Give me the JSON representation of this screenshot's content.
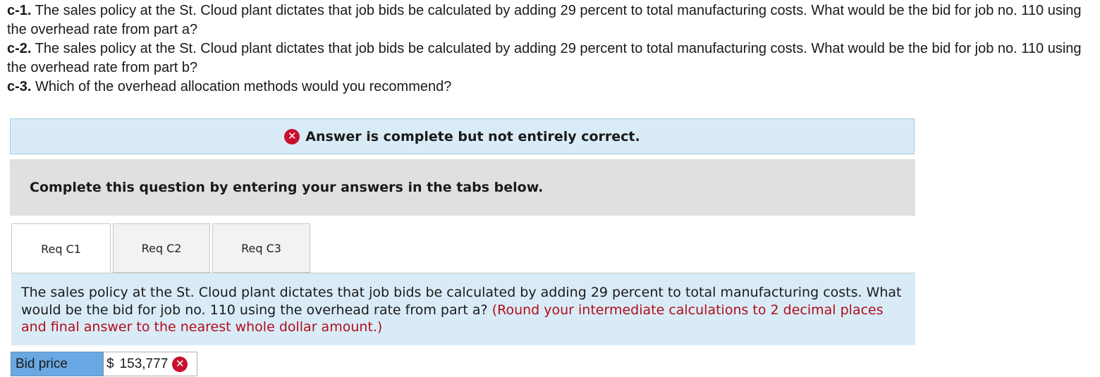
{
  "questions": [
    {
      "label": "c-1.",
      "text": " The sales policy at the St. Cloud plant dictates that job bids be calculated by adding 29 percent to total manufacturing costs. What would be the bid for job no. 110 using the overhead rate from part a?"
    },
    {
      "label": "c-2.",
      "text": " The sales policy at the St. Cloud plant dictates that job bids be calculated by adding 29 percent to total manufacturing costs. What would be the bid for job no. 110 using the overhead rate from part b?"
    },
    {
      "label": "c-3.",
      "text": " Which of the overhead allocation methods would you recommend?"
    }
  ],
  "feedback": {
    "icon": "incorrect-x-icon",
    "message": "Answer is complete but not entirely correct.",
    "icon_color": "#c8102e"
  },
  "instructions": "Complete this question by entering your answers in the tabs below.",
  "tabs": [
    {
      "label": "Req C1",
      "active": true
    },
    {
      "label": "Req C2",
      "active": false
    },
    {
      "label": "Req C3",
      "active": false
    }
  ],
  "panel": {
    "text": "The sales policy at the St. Cloud plant dictates that job bids be calculated by adding 29 percent to total manufacturing costs. What would be the bid for job no. 110 using the overhead rate from part a?",
    "hint": "(Round your intermediate calculations to 2 decimal places and final answer to the nearest whole dollar amount.)"
  },
  "answer": {
    "label": "Bid price",
    "currency": "$",
    "value": "153,777",
    "status_icon": "incorrect-x-icon"
  },
  "colors": {
    "panel_bg": "#d9ebf7",
    "instr_bg": "#e0e0e0",
    "label_bg": "#6aa8e4",
    "hint": "#b00d1a",
    "error": "#c8102e"
  }
}
